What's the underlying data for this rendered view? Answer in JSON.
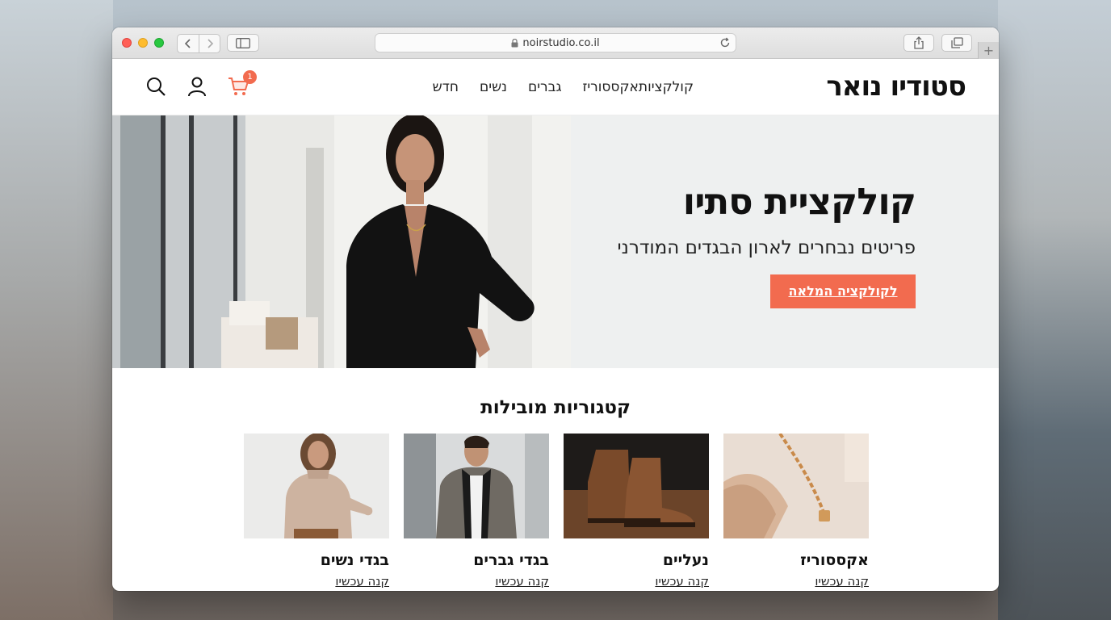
{
  "browser": {
    "url": "noirstudio.co.il"
  },
  "site": {
    "logo": "סטודיו נואר",
    "nav": [
      "חדש",
      "נשים",
      "גברים",
      "אקססוריז",
      "קולקציות"
    ],
    "cart_count": "1",
    "icons": [
      "search-icon",
      "user-icon",
      "cart-icon"
    ]
  },
  "hero": {
    "title": "קולקציית סתיו",
    "subtitle": "פריטים נבחרים לארון הבגדים המודרני",
    "cta": "לקולקציה המלאה"
  },
  "categories": {
    "title": "קטגוריות מובילות",
    "items": [
      {
        "name": "אקססוריז",
        "link": "קנה עכשיו"
      },
      {
        "name": "נעליים",
        "link": "קנה עכשיו"
      },
      {
        "name": "בגדי גברים",
        "link": "קנה עכשיו"
      },
      {
        "name": "בגדי נשים",
        "link": "קנה עכשיו"
      }
    ]
  },
  "colors": {
    "accent": "#f26b4f",
    "text": "#111111",
    "hero_bg": "#eef0f0"
  }
}
